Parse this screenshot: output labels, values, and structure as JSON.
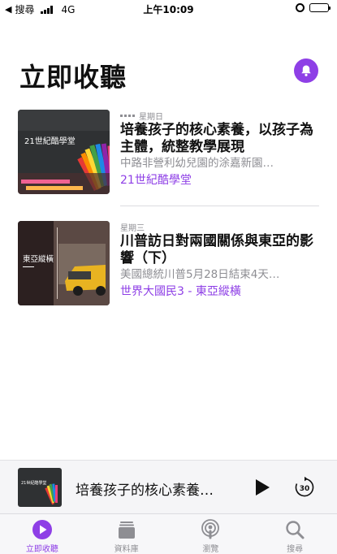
{
  "status_bar": {
    "back_label": "搜尋",
    "network": "4G",
    "time": "上午10:09"
  },
  "page": {
    "title": "立即收聽"
  },
  "episodes": [
    {
      "day": "星期日",
      "title": "培養孩子的核心素養，以孩子為主體，統整教學展現",
      "description": "中路非營利幼兒園的涂嘉新園…",
      "show": "21世紀酷學堂",
      "artwork_text": "21世紀酷學堂"
    },
    {
      "day": "星期三",
      "title": "川普訪日對兩國關係與東亞的影響（下）",
      "description": "美國總統川普5月28日結束4天…",
      "show": "世界大國民3 - 東亞縱橫",
      "artwork_text": "東亞縱橫"
    }
  ],
  "mini_player": {
    "title": "培養孩子的核心素養…",
    "artwork_text": "21世紀酷學堂",
    "skip_seconds": "30"
  },
  "tabs": [
    {
      "label": "立即收聽",
      "icon": "play-circle-icon",
      "active": true
    },
    {
      "label": "資料庫",
      "icon": "library-icon",
      "active": false
    },
    {
      "label": "瀏覽",
      "icon": "podcast-icon",
      "active": false
    },
    {
      "label": "搜尋",
      "icon": "search-icon",
      "active": false
    }
  ],
  "colors": {
    "accent": "#8e3fe6",
    "secondary_text": "#8e8e93"
  }
}
